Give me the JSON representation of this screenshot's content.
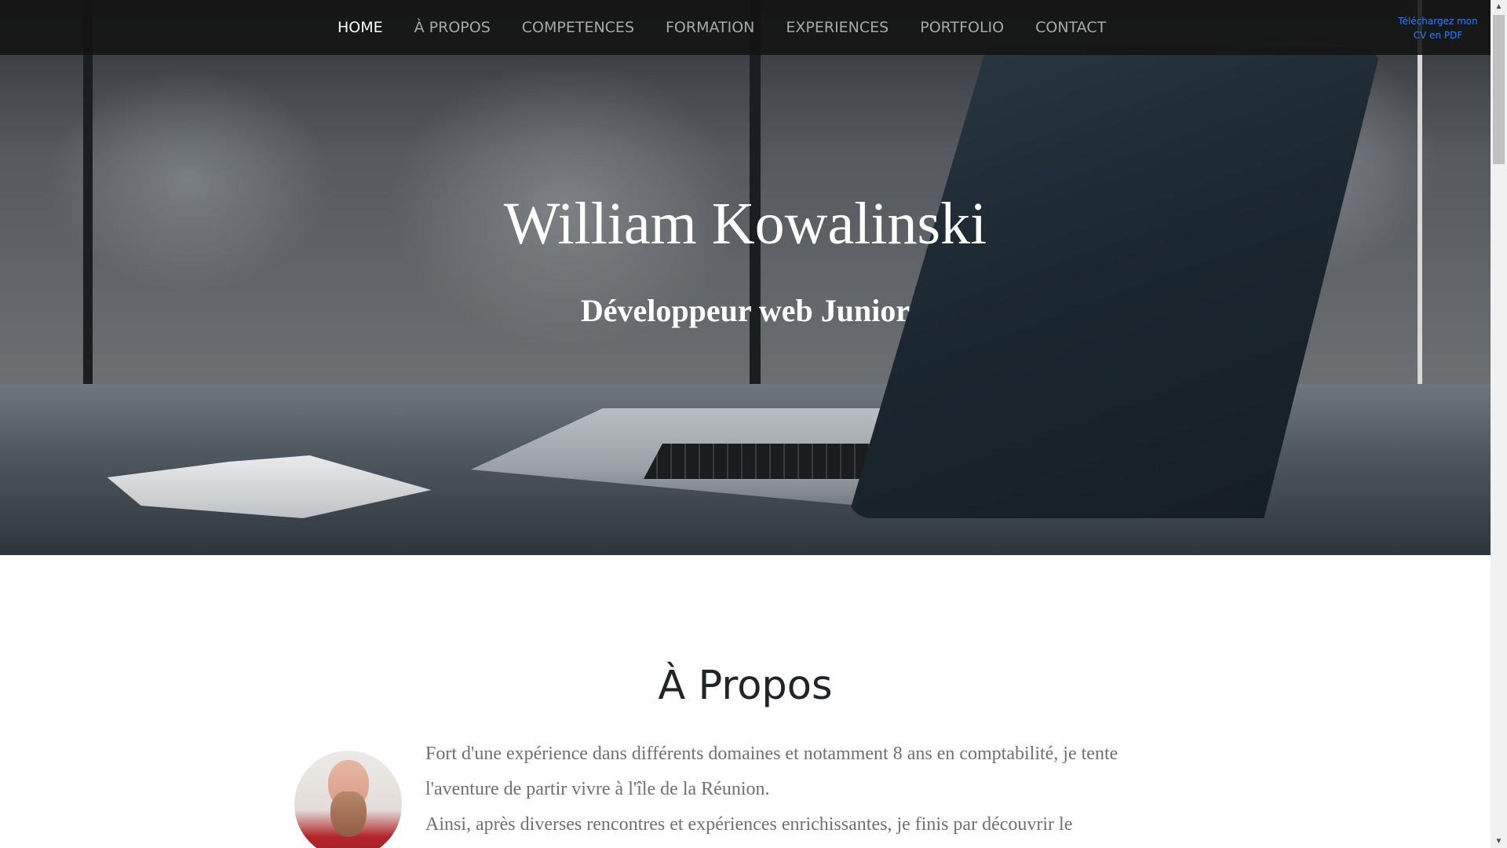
{
  "nav": {
    "items": [
      {
        "label": "HOME",
        "active": true
      },
      {
        "label": "À PROPOS",
        "active": false
      },
      {
        "label": "COMPETENCES",
        "active": false
      },
      {
        "label": "FORMATION",
        "active": false
      },
      {
        "label": "EXPERIENCES",
        "active": false
      },
      {
        "label": "PORTFOLIO",
        "active": false
      },
      {
        "label": "CONTACT",
        "active": false
      }
    ],
    "cv_link": {
      "line1": "Téléchargez mon",
      "line2": "CV en PDF"
    }
  },
  "hero": {
    "title": "William Kowalinski",
    "subtitle": "Développeur web Junior"
  },
  "about": {
    "title": "À Propos",
    "paragraphs": [
      "Fort d'une expérience dans différents domaines et notamment 8 ans en comptabilité, je tente l'aventure de partir vivre à l'île de la Réunion.",
      "Ainsi, après diverses rencontres et expériences enrichissantes, je finis par découvrir le"
    ]
  },
  "colors": {
    "nav_bg": "#121212",
    "nav_active": "#ffffff",
    "nav_inactive": "#a8a8a8",
    "link": "#2f7df5",
    "heading": "#212529",
    "body_text": "#707070"
  },
  "icons": [
    "scroll-up-arrow-icon",
    "scroll-down-arrow-icon"
  ]
}
